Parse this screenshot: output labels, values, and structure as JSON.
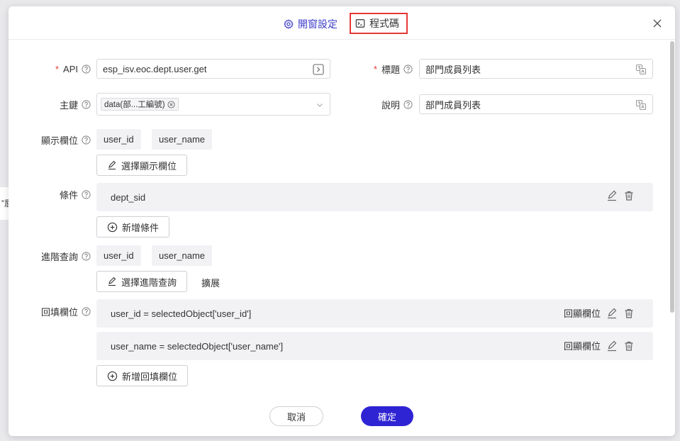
{
  "backdrop": {
    "side_text": "”唇"
  },
  "header": {
    "tabs": [
      {
        "label": "開窗設定",
        "icon": "gear-icon"
      },
      {
        "label": "程式碼",
        "icon": "terminal-icon"
      }
    ],
    "close_icon": "close-icon"
  },
  "form": {
    "api": {
      "label": "API",
      "value": "esp_isv.eoc.dept.user.get"
    },
    "title": {
      "label": "標題",
      "value": "部門成員列表"
    },
    "primary_key": {
      "label": "主鍵",
      "chip": "data(部...工編號)"
    },
    "description": {
      "label": "說明",
      "value": "部門成員列表"
    },
    "display_fields": {
      "label": "顯示欄位",
      "tags": [
        "user_id",
        "user_name"
      ],
      "button": "選擇顯示欄位"
    },
    "conditions": {
      "label": "條件",
      "rows": [
        "dept_sid"
      ],
      "button": "新增條件"
    },
    "advanced_query": {
      "label": "進階查詢",
      "tags": [
        "user_id",
        "user_name"
      ],
      "button": "選擇進階查詢",
      "extra": "擴展"
    },
    "fill_back": {
      "label": "回填欄位",
      "rows": [
        {
          "expr": "user_id = selectedObject['user_id']",
          "tag": "回顯欄位"
        },
        {
          "expr": "user_name = selectedObject['user_name']",
          "tag": "回顯欄位"
        }
      ],
      "button": "新增回填欄位"
    }
  },
  "footer": {
    "cancel": "取消",
    "confirm": "確定"
  },
  "colors": {
    "accent": "#2f24d3",
    "tab_active": "#3b3bc9",
    "highlight": "#e53935"
  }
}
